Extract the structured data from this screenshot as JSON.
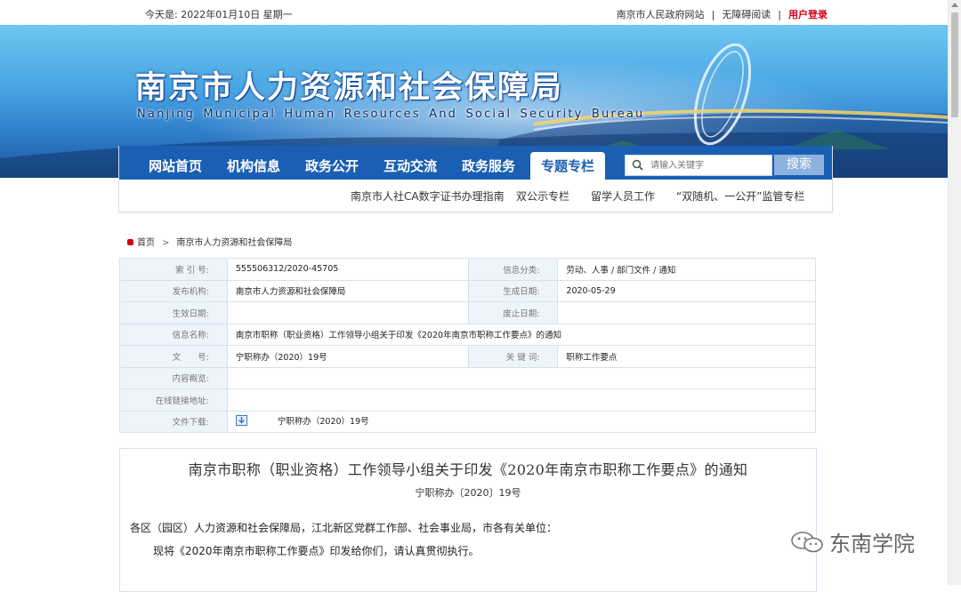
{
  "topbar": {
    "date_text": "今天是: 2022年01月10日  星期一",
    "links": [
      "南京市人民政府网站",
      "无障碍阅读"
    ],
    "separator": "|",
    "login": "用户登录"
  },
  "banner": {
    "title": "南京市人力资源和社会保障局",
    "subtitle": "Nanjing Municipal Human Resources And Social Security Bureau"
  },
  "nav": {
    "items": [
      "网站首页",
      "机构信息",
      "政务公开",
      "互动交流",
      "政务服务",
      "专题专栏"
    ],
    "active_index": 5,
    "search_placeholder": "请输入关键字",
    "search_button": "搜索",
    "sub_items": [
      "南京市人社CA数字证书办理指南",
      "双公示专栏",
      "留学人员工作",
      "“双随机、一公开”监管专栏"
    ]
  },
  "breadcrumb": {
    "home": "首页",
    "sep": ">",
    "current": "南京市人力资源和社会保障局"
  },
  "info": {
    "index_label": "索 引 号:",
    "index_value": "555506312/2020-45705",
    "category_label": "信息分类:",
    "category_value": "劳动、人事 / 部门文件 / 通知",
    "publisher_label": "发布机构:",
    "publisher_value": "南京市人力资源和社会保障局",
    "created_label": "生成日期:",
    "created_value": "2020-05-29",
    "effective_label": "生效日期:",
    "effective_value": "",
    "expire_label": "废止日期:",
    "expire_value": "",
    "name_label": "信息名称:",
    "name_value": "南京市职称（职业资格）工作领导小组关于印发《2020年南京市职称工作要点》的通知",
    "docno_label": "文　　号:",
    "docno_value": "宁职称办（2020）19号",
    "keyword_label": "关 键 词:",
    "keyword_value": "职称工作要点",
    "summary_label": "内容概览:",
    "summary_value": "",
    "link_label": "在线链接地址:",
    "link_value": "",
    "download_label": "文件下载:",
    "download_value": "宁职称办（2020）19号"
  },
  "article": {
    "title": "南京市职称（职业资格）工作领导小组关于印发《2020年南京市职称工作要点》的通知",
    "doc_number": "宁职称办〔2020〕19号",
    "para1": "各区（园区）人力资源和社会保障局，江北新区党群工作部、社会事业局，市各有关单位：",
    "para2": "现将《2020年南京市职称工作要点》印发给你们，请认真贯彻执行。"
  },
  "watermark": {
    "text": "东南学院"
  }
}
